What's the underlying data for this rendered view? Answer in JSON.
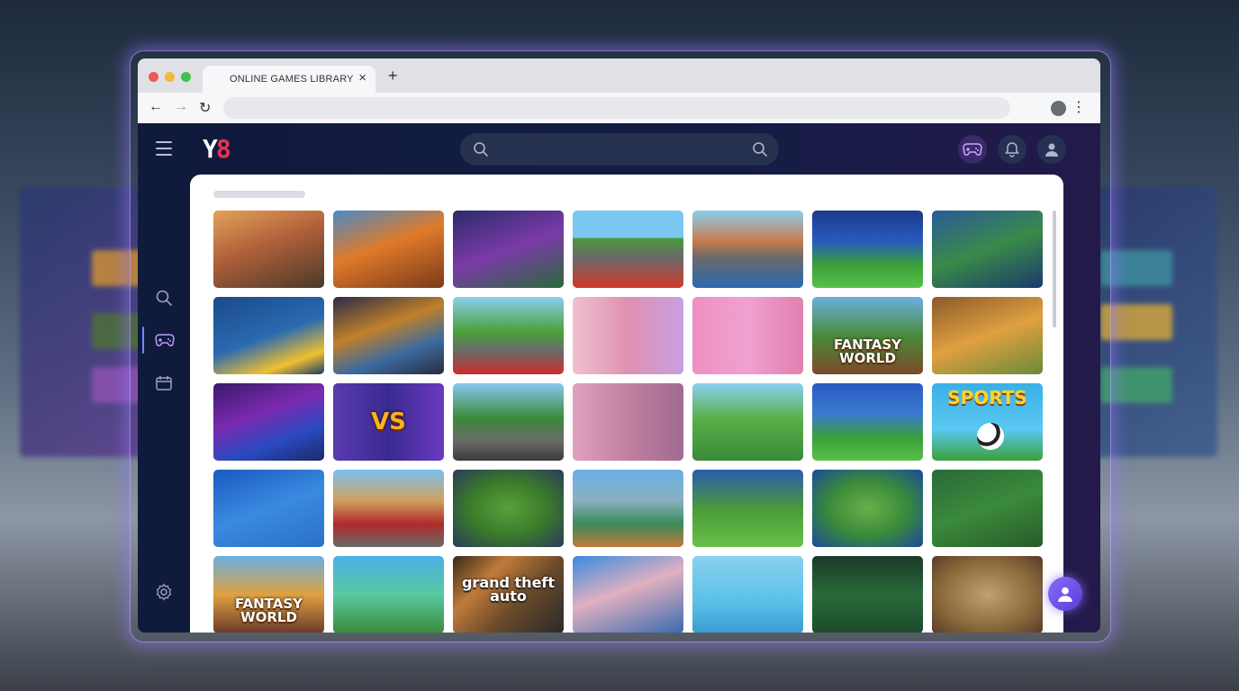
{
  "browser": {
    "tab_title": "ONLINE GAMES LIBRARY",
    "close_glyph": "×",
    "new_tab_glyph": "+",
    "back_glyph": "←",
    "forward_glyph": "→",
    "reload_glyph": "↻",
    "menu_glyph": "⋮"
  },
  "app": {
    "logo": {
      "part1": "Y",
      "part2": "8"
    },
    "accent_color": "#8a6cff",
    "header_icons": [
      "gamepad-icon",
      "bell-icon",
      "user-icon"
    ],
    "sidebar_icons": [
      "search-icon",
      "gamepad-icon",
      "calendar-icon",
      "settings-icon"
    ]
  },
  "library": {
    "tiles": [
      {
        "text": "",
        "bg": "linear-gradient(160deg,#e3a25a 0%,#b0603a 45%,#4a3a2a 100%)"
      },
      {
        "text": "",
        "bg": "linear-gradient(160deg,#4a8ac8 0%,#e07a2a 45%,#7a3a1a 100%)"
      },
      {
        "text": "",
        "bg": "linear-gradient(160deg,#2b2b6a 0%,#7a3aa8 50%,#2a6a3a 100%)"
      },
      {
        "text": "",
        "bg": "linear-gradient(180deg,#7ac8f0 0%,#7ac8f0 35%,#4a9a3a 36%,#6a6a6a 60%,#d03a2a 100%)"
      },
      {
        "text": "",
        "bg": "linear-gradient(180deg,#8ad0f0 0%,#c87a4a 40%,#6a6a6a 60%,#2a6ab0 100%)"
      },
      {
        "text": "",
        "bg": "linear-gradient(180deg,#1a3a8a 0%,#2a5ac0 40%,#3aa03a 70%,#5ac04a 100%)"
      },
      {
        "text": "",
        "bg": "linear-gradient(160deg,#2a5a9a 0%,#3a8a4a 50%,#1a3a6a 100%)"
      },
      {
        "text": "",
        "bg": "linear-gradient(160deg,#1a4a8a 0%,#2a6ab0 50%,#f0c030 80%,#1a3a6a 100%)"
      },
      {
        "text": "",
        "bg": "linear-gradient(160deg,#2a2a4a 0%,#c0802a 40%,#3a6aa0 70%,#2a2a3a 100%)"
      },
      {
        "text": "",
        "bg": "linear-gradient(180deg,#8ad0f0 0%,#4aa03a 45%,#6a6a6a 70%,#d02a2a 100%)"
      },
      {
        "text": "",
        "bg": "linear-gradient(90deg,#f0c0d0 0%,#e090b0 50%,#c8a0e0 100%)"
      },
      {
        "text": "",
        "bg": "linear-gradient(90deg,#f090c0 0%,#f0a0d0 50%,#e080b0 100%)"
      },
      {
        "text": "FANTASY WORLD",
        "bg": "linear-gradient(180deg,#6ab0e0 0%,#4a8a3a 50%,#7a4a2a 100%)"
      },
      {
        "text": "",
        "bg": "linear-gradient(160deg,#8a5a2a 0%,#e0a040 50%,#6a8a3a 100%)"
      },
      {
        "text": "",
        "bg": "linear-gradient(160deg,#3a1a6a 0%,#7a2ab0 40%,#2a4ac0 70%,#1a2a6a 100%)"
      },
      {
        "text": "VS",
        "bg": "linear-gradient(90deg,#5a3ab0 0%,#3a2a90 50%,#6a3ac0 100%)"
      },
      {
        "text": "",
        "bg": "linear-gradient(180deg,#8ac8f0 0%,#3a8a3a 45%,#6a6a6a 75%,#3a3a3a 100%)"
      },
      {
        "text": "",
        "bg": "linear-gradient(90deg,#e0a0c0 0%,#c080a0 50%,#a06a90 100%)"
      },
      {
        "text": "",
        "bg": "linear-gradient(180deg,#8ad0f0 0%,#5ab04a 45%,#3a8a3a 100%)"
      },
      {
        "text": "",
        "bg": "linear-gradient(180deg,#2a5ac0 0%,#3a7ad0 40%,#3aa03a 70%,#5ac04a 100%)"
      },
      {
        "text": "SPORTS",
        "bg": "linear-gradient(180deg,#3ab0e8 0%,#5ac8f0 60%,#3aa03a 100%)"
      },
      {
        "text": "",
        "bg": "linear-gradient(160deg,#1a5ac0 0%,#3a8ae0 50%,#2a70c8 100%)"
      },
      {
        "text": "",
        "bg": "linear-gradient(180deg,#7ac0f0 0%,#d0a060 40%,#b02a2a 70%,#6a6a6a 100%)"
      },
      {
        "text": "",
        "bg": "radial-gradient(ellipse at center,#5aa03a 0%,#3a7a2a 50%,#2a3a5a 100%)"
      },
      {
        "text": "",
        "bg": "linear-gradient(180deg,#6ab0e8 0%,#8ab0c0 40%,#3a8a5a 70%,#c07a3a 100%)"
      },
      {
        "text": "",
        "bg": "linear-gradient(180deg,#2a5ab0 0%,#4a9a3a 50%,#6ac04a 100%)"
      },
      {
        "text": "",
        "bg": "radial-gradient(ellipse at center,#6ab04a 0%,#3a8a3a 50%,#1a4a9a 100%)"
      },
      {
        "text": "",
        "bg": "linear-gradient(160deg,#2a6a3a 0%,#3a8a3a 50%,#2a5a2a 100%)"
      },
      {
        "text": "FANTASY WORLD",
        "bg": "linear-gradient(180deg,#6ab0e0 0%,#e0a040 50%,#6a3a2a 100%)"
      },
      {
        "text": "",
        "bg": "linear-gradient(180deg,#4ab0e8 0%,#5ac8a0 50%,#3a8a3a 100%)"
      },
      {
        "text": "grand theft auto",
        "bg": "linear-gradient(135deg,#3a2a1a 0%,#c07a3a 30%,#6a4a2a 60%,#2a2a2a 100%)"
      },
      {
        "text": "",
        "bg": "linear-gradient(160deg,#3a8ae0 0%,#e0b0c0 45%,#3a6ab0 100%)"
      },
      {
        "text": "",
        "bg": "linear-gradient(180deg,#8ad0f0 0%,#5ac0e8 60%,#3a9ad0 100%)"
      },
      {
        "text": "",
        "bg": "linear-gradient(180deg,#1a3a2a 0%,#2a6a3a 50%,#1a4a2a 100%)"
      },
      {
        "text": "",
        "bg": "radial-gradient(ellipse at center,#c0a070 0%,#8a6a3a 60%,#5a3a2a 100%)"
      }
    ]
  }
}
